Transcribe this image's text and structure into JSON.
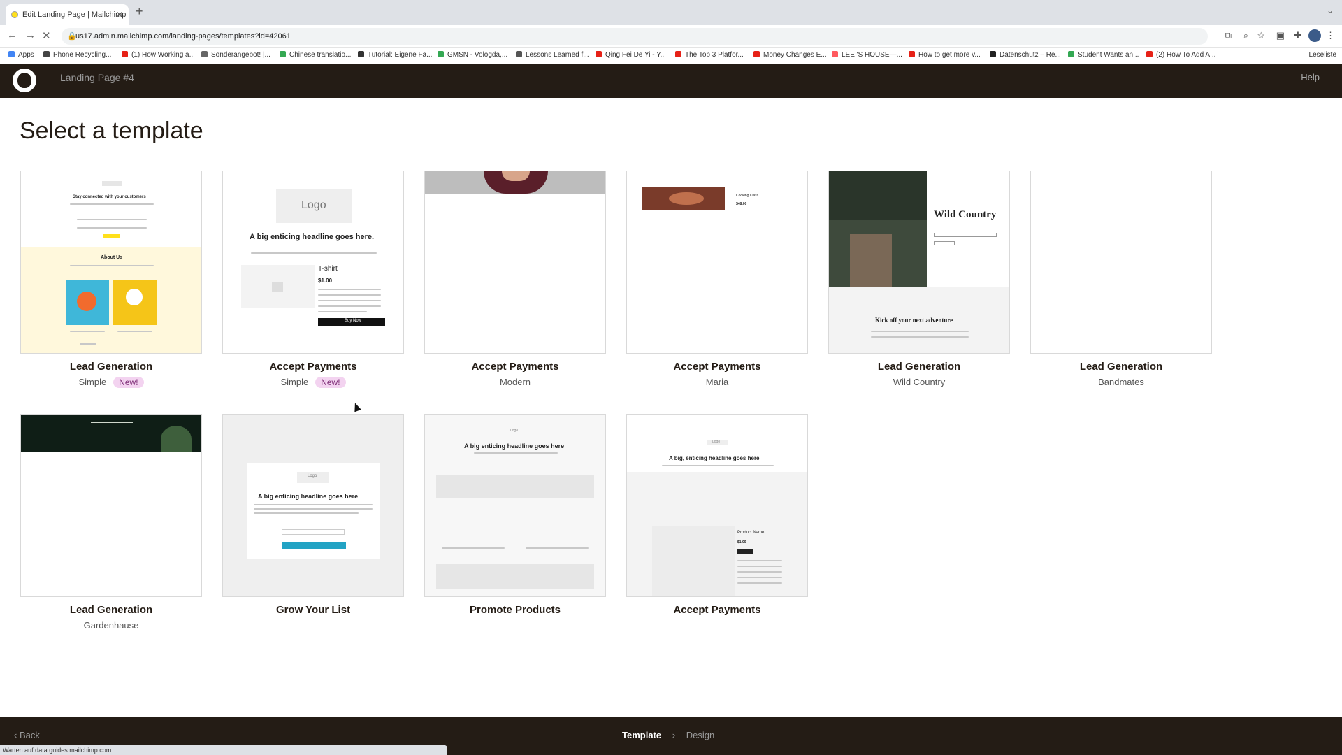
{
  "browser": {
    "tab_title": "Edit Landing Page | Mailchimp",
    "url": "us17.admin.mailchimp.com/landing-pages/templates?id=42061",
    "bookmarks": [
      {
        "label": "Apps",
        "color": "#4285f4"
      },
      {
        "label": "Phone Recycling...",
        "color": "#444444"
      },
      {
        "label": "(1) How Working a...",
        "color": "#e62117"
      },
      {
        "label": "Sonderangebot! |...",
        "color": "#666666"
      },
      {
        "label": "Chinese translatio...",
        "color": "#34a853"
      },
      {
        "label": "Tutorial: Eigene Fa...",
        "color": "#333333"
      },
      {
        "label": "GMSN - Vologda,...",
        "color": "#34a853"
      },
      {
        "label": "Lessons Learned f...",
        "color": "#555555"
      },
      {
        "label": "Qing Fei De Yi - Y...",
        "color": "#e62117"
      },
      {
        "label": "The Top 3 Platfor...",
        "color": "#e62117"
      },
      {
        "label": "Money Changes E...",
        "color": "#e62117"
      },
      {
        "label": "LEE 'S HOUSE—...",
        "color": "#ff5a5f"
      },
      {
        "label": "How to get more v...",
        "color": "#e62117"
      },
      {
        "label": "Datenschutz – Re...",
        "color": "#222222"
      },
      {
        "label": "Student Wants an...",
        "color": "#34a853"
      },
      {
        "label": "(2) How To Add A...",
        "color": "#e62117"
      }
    ],
    "reading_list": "Leseliste",
    "status_text": "Warten auf data.guides.mailchimp.com..."
  },
  "header": {
    "title": "Landing Page #4",
    "help": "Help"
  },
  "main": {
    "title": "Select a template",
    "badge_new": "New!",
    "templates": [
      {
        "title": "Lead Generation",
        "subtitle": "Simple"
      },
      {
        "title": "Accept Payments",
        "subtitle": "Simple"
      },
      {
        "title": "Accept Payments",
        "subtitle": "Modern"
      },
      {
        "title": "Accept Payments",
        "subtitle": "Maria"
      },
      {
        "title": "Lead Generation",
        "subtitle": "Wild Country"
      },
      {
        "title": "Lead Generation",
        "subtitle": "Bandmates"
      },
      {
        "title": "Lead Generation",
        "subtitle": "Gardenhause"
      },
      {
        "title": "Grow Your List",
        "subtitle": ""
      },
      {
        "title": "Promote Products",
        "subtitle": ""
      },
      {
        "title": "Accept Payments",
        "subtitle": ""
      }
    ],
    "thumb_text": {
      "t0_headline": "Stay connected with your customers",
      "t0_about": "About Us",
      "t1_logo": "Logo",
      "t1_headline": "A big enticing headline goes here.",
      "t1_product": "T-shirt",
      "t1_price": "$1.00",
      "t1_button": "Buy Now",
      "t3_product": "Cooking Class",
      "t3_price": "$48.00",
      "t4_title": "Wild Country",
      "t4_tagline": "Kick off your next adventure",
      "t7_logo": "Logo",
      "t7_headline": "A big enticing headline goes here",
      "t8_logo": "Logo",
      "t8_headline": "A big enticing headline goes here",
      "t9_logo": "Logo",
      "t9_headline": "A big, enticing headline goes here",
      "t9_product": "Product Name",
      "t9_price": "$1.00"
    }
  },
  "footer": {
    "back": "Back",
    "step_current": "Template",
    "step_next": "Design"
  },
  "colors": {
    "header_bg": "#241c15",
    "badge_bg": "#f3d3f0",
    "accent": "#007c89"
  }
}
